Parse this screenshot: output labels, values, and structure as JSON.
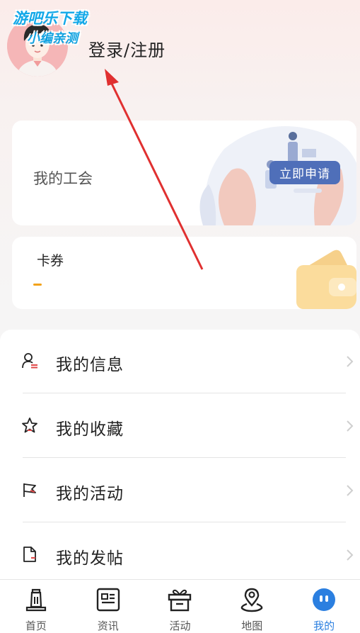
{
  "watermark": {
    "line1": "游吧乐下载",
    "line2": "小编亲测"
  },
  "header": {
    "login_label": "登录/注册"
  },
  "union_card": {
    "title": "我的工会",
    "apply_label": "立即申请"
  },
  "coupon_card": {
    "title": "卡券"
  },
  "menu": {
    "items": [
      {
        "label": "我的信息",
        "icon": "user-info-icon"
      },
      {
        "label": "我的收藏",
        "icon": "star-icon"
      },
      {
        "label": "我的活动",
        "icon": "flag-icon"
      },
      {
        "label": "我的发帖",
        "icon": "document-icon"
      }
    ]
  },
  "tabbar": {
    "tabs": [
      {
        "label": "首页",
        "icon": "home-icon"
      },
      {
        "label": "资讯",
        "icon": "news-icon"
      },
      {
        "label": "活动",
        "icon": "gift-icon"
      },
      {
        "label": "地图",
        "icon": "map-pin-icon"
      },
      {
        "label": "我的",
        "icon": "profile-icon"
      }
    ],
    "active_index": 4
  },
  "colors": {
    "accent_blue": "#2b7fe0",
    "apply_button": "#4f6fb9",
    "coupon_dash": "#f2a21b",
    "annotation_arrow": "#e03030"
  }
}
